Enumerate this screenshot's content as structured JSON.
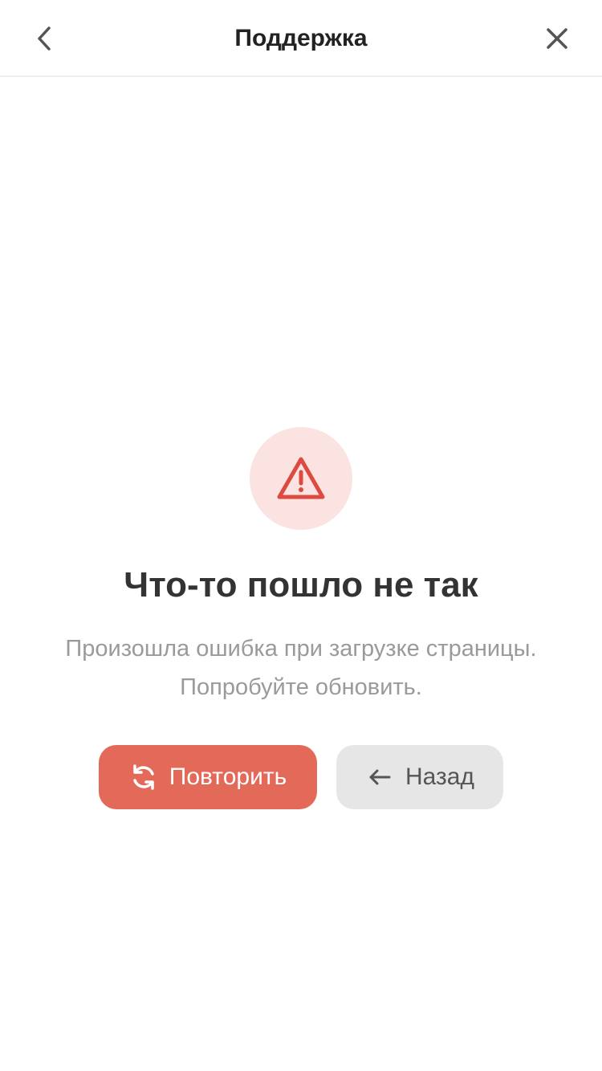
{
  "header": {
    "title": "Поддержка",
    "back_icon": "chevron-left-icon",
    "close_icon": "close-icon"
  },
  "error": {
    "icon": "warning-triangle-icon",
    "title": "Что-то пошло не так",
    "message_line1": "Произошла ошибка при загрузке страницы.",
    "message_line2": "Попробуйте обновить."
  },
  "actions": {
    "retry_label": "Повторить",
    "retry_icon": "refresh-icon",
    "back_label": "Назад",
    "back_icon": "arrow-left-icon"
  },
  "colors": {
    "accent": "#e36a58",
    "warning_icon": "#dc4a40",
    "warning_circle": "#fae3e1",
    "secondary_button": "#e6e6e6"
  }
}
